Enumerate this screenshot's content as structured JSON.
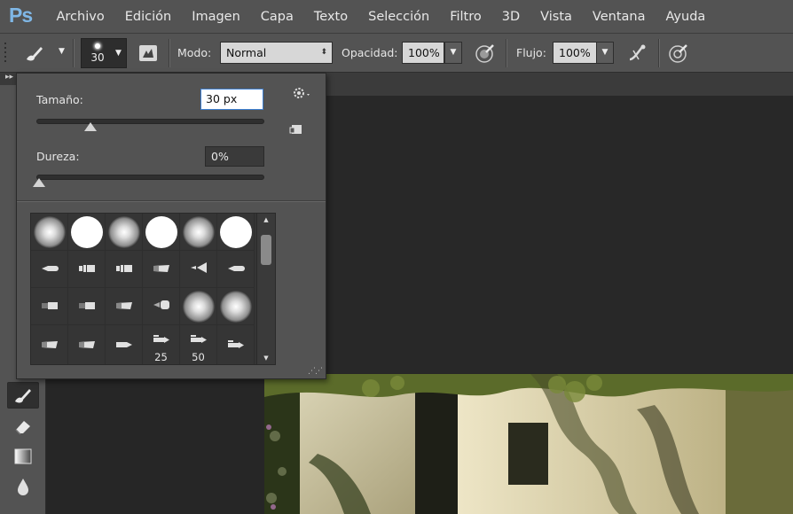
{
  "app": {
    "logo": "Ps"
  },
  "menu": [
    "Archivo",
    "Edición",
    "Imagen",
    "Capa",
    "Texto",
    "Selección",
    "Filtro",
    "3D",
    "Vista",
    "Ventana",
    "Ayuda"
  ],
  "options": {
    "brush_size": "30",
    "mode_label": "Modo:",
    "mode_value": "Normal",
    "opacity_label": "Opacidad:",
    "opacity_value": "100%",
    "flow_label": "Flujo:",
    "flow_value": "100%"
  },
  "brush_panel": {
    "size_label": "Tamaño:",
    "size_value": "30 px",
    "size_slider_fraction": 0.15,
    "hardness_label": "Dureza:",
    "hardness_value": "0%",
    "hardness_slider_fraction": 0.0,
    "presets": [
      {
        "shape": "soft-round"
      },
      {
        "shape": "hard-round"
      },
      {
        "shape": "soft-round"
      },
      {
        "shape": "hard-round"
      },
      {
        "shape": "soft-round"
      },
      {
        "shape": "hard-round"
      },
      {
        "shape": "tip-round"
      },
      {
        "shape": "tip-bristle"
      },
      {
        "shape": "tip-bristle"
      },
      {
        "shape": "tip-angled"
      },
      {
        "shape": "tip-fan"
      },
      {
        "shape": "tip-round"
      },
      {
        "shape": "tip-flat"
      },
      {
        "shape": "tip-flat"
      },
      {
        "shape": "tip-angled"
      },
      {
        "shape": "tip-blunt"
      },
      {
        "shape": "soft-round"
      },
      {
        "shape": "soft-round"
      },
      {
        "shape": "tip-angled"
      },
      {
        "shape": "tip-angled"
      },
      {
        "shape": "tip-pointed"
      },
      {
        "shape": "tip-pencil",
        "label": "25"
      },
      {
        "shape": "tip-pencil",
        "label": "50"
      },
      {
        "shape": "tip-pencil"
      }
    ]
  },
  "icons": {
    "brush": "brush-icon",
    "toggle_panel": "brush-panel-toggle-icon",
    "pressure_opacity": "airbrush-opacity-icon",
    "airbrush": "airbrush-icon",
    "pressure_size": "pressure-size-icon",
    "gear": "gear-icon",
    "new_preset": "new-preset-icon"
  },
  "colors": {
    "chrome": "#535353",
    "workspace": "#262626",
    "accent": "#3e7fd1",
    "logo": "#7fb7e6"
  }
}
